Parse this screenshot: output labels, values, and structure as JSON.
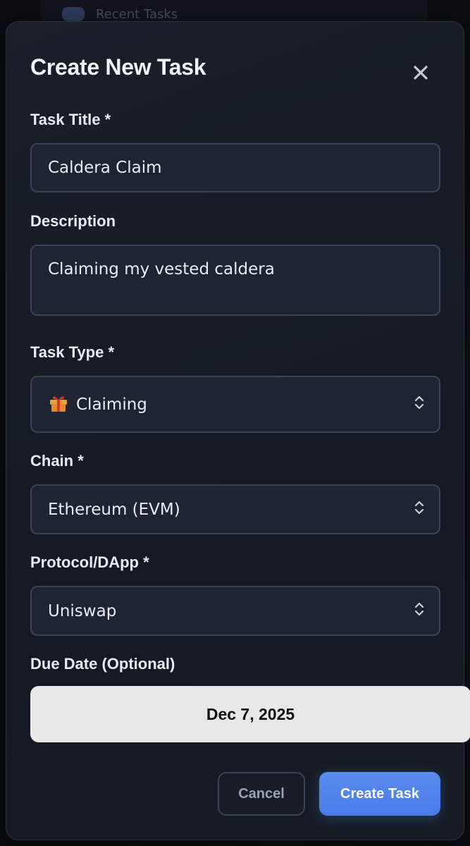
{
  "background": {
    "behind_text": "Recent Tasks"
  },
  "modal": {
    "title": "Create New Task",
    "close_icon": "close-icon"
  },
  "form": {
    "task_title": {
      "label": "Task Title *",
      "value": "Caldera Claim"
    },
    "description": {
      "label": "Description",
      "value": "Claiming my vested caldera"
    },
    "task_type": {
      "label": "Task Type *",
      "icon": "gift-icon",
      "value": "Claiming"
    },
    "chain": {
      "label": "Chain *",
      "value": "Ethereum (EVM)"
    },
    "protocol": {
      "label": "Protocol/DApp *",
      "value": "Uniswap"
    },
    "due_date": {
      "label": "Due Date (Optional)",
      "value": "Dec 7, 2025"
    }
  },
  "actions": {
    "cancel_label": "Cancel",
    "create_label": "Create Task"
  },
  "colors": {
    "accent": "#4a7be6",
    "field_bg": "#1e2531",
    "modal_bg": "#1a1f28"
  }
}
